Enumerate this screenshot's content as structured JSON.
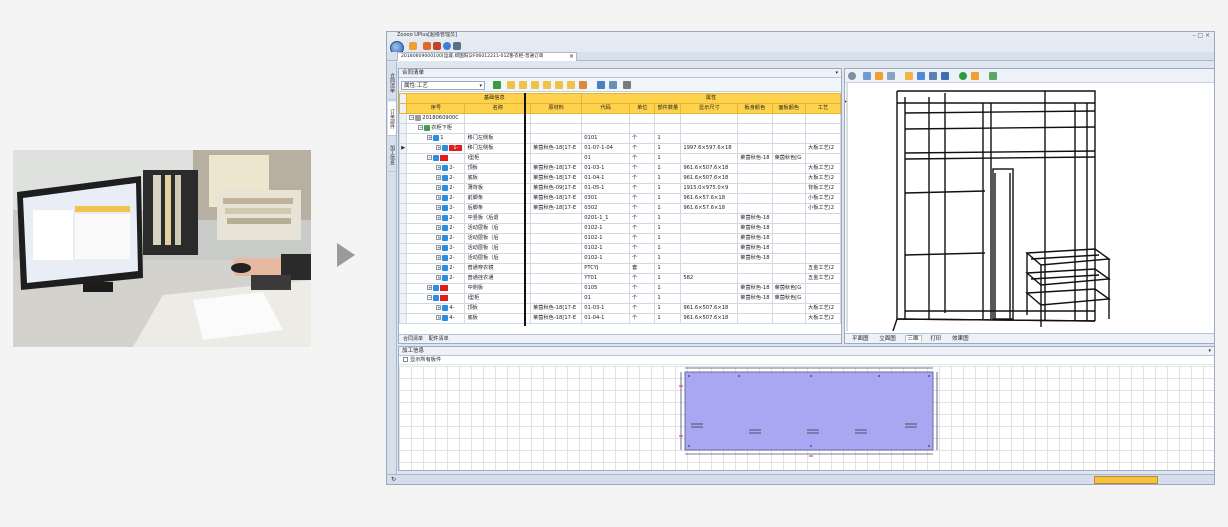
{
  "app": {
    "title": "Zoooo UPlus[超级管理员]",
    "document_tab": "20180609000100[运城.郑国阳]2F06012211-01Z卧衣柜-普通订单",
    "window_controls": [
      "–",
      "□",
      "×"
    ]
  },
  "left_vtabs": [
    "合同清单",
    "订单部件",
    "加工信息"
  ],
  "contract_pane": {
    "header": "合同清单",
    "filter_select": "属性:工艺",
    "group_headers": {
      "base": "基础信息",
      "props": "属性"
    },
    "columns": [
      "序号",
      "名称",
      "原材料",
      "代码",
      "单位",
      "部件数量",
      "显示尺寸",
      "板身颜色",
      "面板颜色",
      "工艺"
    ],
    "rows": [
      {
        "depth": 0,
        "tw": "−",
        "seq": "2018060900C",
        "name": "",
        "mat": "",
        "code": "",
        "unit": "",
        "qty": "",
        "size": "",
        "c1": "",
        "c2": "",
        "craft": "",
        "icon": "#9a9a9a",
        "red": false,
        "ptr": false
      },
      {
        "depth": 1,
        "tw": "−",
        "seq": "衣柜下柜",
        "name": "",
        "mat": "",
        "code": "",
        "unit": "",
        "qty": "",
        "size": "",
        "c1": "",
        "c2": "",
        "craft": "",
        "icon": "#3da04a",
        "red": false,
        "ptr": false
      },
      {
        "depth": 2,
        "tw": "+",
        "seq": "1",
        "name": "移门左侧板",
        "mat": "",
        "code": "0101",
        "unit": "个",
        "qty": "1",
        "size": "",
        "c1": "",
        "c2": "",
        "craft": "",
        "icon": "#2b8de0",
        "red": false,
        "ptr": false
      },
      {
        "depth": 3,
        "tw": "+",
        "seq": "1-",
        "name": "移门左侧板",
        "mat": "莱茵秋色-18[17-E",
        "code": "01-07-1-04",
        "unit": "个",
        "qty": "1",
        "size": "1997.6×597.6×18",
        "c1": "",
        "c2": "",
        "craft": "大板工艺(2",
        "icon": "#2b8de0",
        "red": true,
        "ptr": true
      },
      {
        "depth": 2,
        "tw": "−",
        "seq": "",
        "name": "I型柜",
        "mat": "",
        "code": "01",
        "unit": "个",
        "qty": "1",
        "size": "",
        "c1": "莱茵秋色-18",
        "c2": "莱茵秋色[G",
        "craft": "",
        "icon": "#2b8de0",
        "red": true,
        "ptr": false
      },
      {
        "depth": 3,
        "tw": "+",
        "seq": "2-",
        "name": "顶板",
        "mat": "莱茵秋色-18[17-E",
        "code": "01-03-1",
        "unit": "个",
        "qty": "1",
        "size": "961.6×507.6×18",
        "c1": "",
        "c2": "",
        "craft": "大板工艺(2",
        "icon": "#2b8de0",
        "red": false,
        "ptr": false
      },
      {
        "depth": 3,
        "tw": "+",
        "seq": "2-",
        "name": "底板",
        "mat": "莱茵秋色-18[17-E",
        "code": "01-04-1",
        "unit": "个",
        "qty": "1",
        "size": "961.6×507.6×18",
        "c1": "",
        "c2": "",
        "craft": "大板工艺(2",
        "icon": "#2b8de0",
        "red": false,
        "ptr": false
      },
      {
        "depth": 3,
        "tw": "+",
        "seq": "2-",
        "name": "薄背板",
        "mat": "莱茵秋色-09[17-E",
        "code": "01-05-1",
        "unit": "个",
        "qty": "1",
        "size": "1915.0×975.0×9",
        "c1": "",
        "c2": "",
        "craft": "背板工艺(2",
        "icon": "#2b8de0",
        "red": false,
        "ptr": false
      },
      {
        "depth": 3,
        "tw": "+",
        "seq": "2-",
        "name": "前脚条",
        "mat": "莱茵秋色-18[17-E",
        "code": "0301",
        "unit": "个",
        "qty": "1",
        "size": "961.6×57.6×18",
        "c1": "",
        "c2": "",
        "craft": "小板工艺(2",
        "icon": "#2b8de0",
        "red": false,
        "ptr": false
      },
      {
        "depth": 3,
        "tw": "+",
        "seq": "2-",
        "name": "后脚条",
        "mat": "莱茵秋色-18[17-E",
        "code": "0302",
        "unit": "个",
        "qty": "1",
        "size": "961.6×57.6×18",
        "c1": "",
        "c2": "",
        "craft": "小板工艺(2",
        "icon": "#2b8de0",
        "red": false,
        "ptr": false
      },
      {
        "depth": 3,
        "tw": "+",
        "seq": "2-",
        "name": "中竖板（后退",
        "mat": "",
        "code": "0201-1_1",
        "unit": "个",
        "qty": "1",
        "size": "",
        "c1": "莱茵秋色-18",
        "c2": "",
        "craft": "",
        "icon": "#2b8de0",
        "red": false,
        "ptr": false
      },
      {
        "depth": 3,
        "tw": "+",
        "seq": "2-",
        "name": "活动层板（后",
        "mat": "",
        "code": "0102-1",
        "unit": "个",
        "qty": "1",
        "size": "",
        "c1": "莱茵秋色-18",
        "c2": "",
        "craft": "",
        "icon": "#2b8de0",
        "red": false,
        "ptr": false
      },
      {
        "depth": 3,
        "tw": "+",
        "seq": "2-",
        "name": "活动层板（后",
        "mat": "",
        "code": "0102-1",
        "unit": "个",
        "qty": "1",
        "size": "",
        "c1": "莱茵秋色-18",
        "c2": "",
        "craft": "",
        "icon": "#2b8de0",
        "red": false,
        "ptr": false
      },
      {
        "depth": 3,
        "tw": "+",
        "seq": "2-",
        "name": "活动层板（后",
        "mat": "",
        "code": "0102-1",
        "unit": "个",
        "qty": "1",
        "size": "",
        "c1": "莱茵秋色-18",
        "c2": "",
        "craft": "",
        "icon": "#2b8de0",
        "red": false,
        "ptr": false
      },
      {
        "depth": 3,
        "tw": "+",
        "seq": "2-",
        "name": "活动层板（后",
        "mat": "",
        "code": "0102-1",
        "unit": "个",
        "qty": "1",
        "size": "",
        "c1": "莱茵秋色-18",
        "c2": "",
        "craft": "",
        "icon": "#2b8de0",
        "red": false,
        "ptr": false
      },
      {
        "depth": 3,
        "tw": "+",
        "seq": "2-",
        "name": "普通穿衣镜",
        "mat": "",
        "code": "PTCYJ",
        "unit": "套",
        "qty": "1",
        "size": "",
        "c1": "",
        "c2": "",
        "craft": "五金工艺(2",
        "icon": "#2b8de0",
        "red": false,
        "ptr": false
      },
      {
        "depth": 3,
        "tw": "+",
        "seq": "2-",
        "name": "普通挂衣通",
        "mat": "",
        "code": "YT01",
        "unit": "个",
        "qty": "1",
        "size": "582",
        "c1": "",
        "c2": "",
        "craft": "五金工艺(2",
        "icon": "#2b8de0",
        "red": false,
        "ptr": false
      },
      {
        "depth": 2,
        "tw": "+",
        "seq": "",
        "name": "中侧板",
        "mat": "",
        "code": "0105",
        "unit": "个",
        "qty": "1",
        "size": "",
        "c1": "莱茵秋色-18",
        "c2": "莱茵秋色[G",
        "craft": "",
        "icon": "#2b8de0",
        "red": true,
        "ptr": false
      },
      {
        "depth": 2,
        "tw": "−",
        "seq": "",
        "name": "I型柜",
        "mat": "",
        "code": "01",
        "unit": "个",
        "qty": "1",
        "size": "",
        "c1": "莱茵秋色-18",
        "c2": "莱茵秋色[G",
        "craft": "",
        "icon": "#2b8de0",
        "red": true,
        "ptr": false
      },
      {
        "depth": 3,
        "tw": "+",
        "seq": "4-",
        "name": "顶板",
        "mat": "莱茵秋色-18[17-E",
        "code": "01-03-1",
        "unit": "个",
        "qty": "1",
        "size": "961.6×507.6×18",
        "c1": "",
        "c2": "",
        "craft": "大板工艺(2",
        "icon": "#2b8de0",
        "red": false,
        "ptr": false
      },
      {
        "depth": 3,
        "tw": "+",
        "seq": "4-",
        "name": "底板",
        "mat": "莱茵秋色-18[17-E",
        "code": "01-04-1",
        "unit": "个",
        "qty": "1",
        "size": "961.6×507.6×18",
        "c1": "",
        "c2": "",
        "craft": "大板工艺(2",
        "icon": "#2b8de0",
        "red": false,
        "ptr": false
      }
    ],
    "bottom_tabs": [
      "合同清单",
      "配件清单"
    ]
  },
  "view_pane": {
    "tabs": [
      "平面图",
      "立面图",
      "三维",
      "打印",
      "效果图"
    ],
    "active_tab": "三维"
  },
  "process_pane": {
    "header": "加工信息",
    "checkbox_label": "显示所有板件",
    "panel_color": "#a9a6f2"
  },
  "colors": {
    "grid_header": "#ffd24d",
    "highlight": "#e31b1b",
    "accent": "#2b8de0"
  }
}
